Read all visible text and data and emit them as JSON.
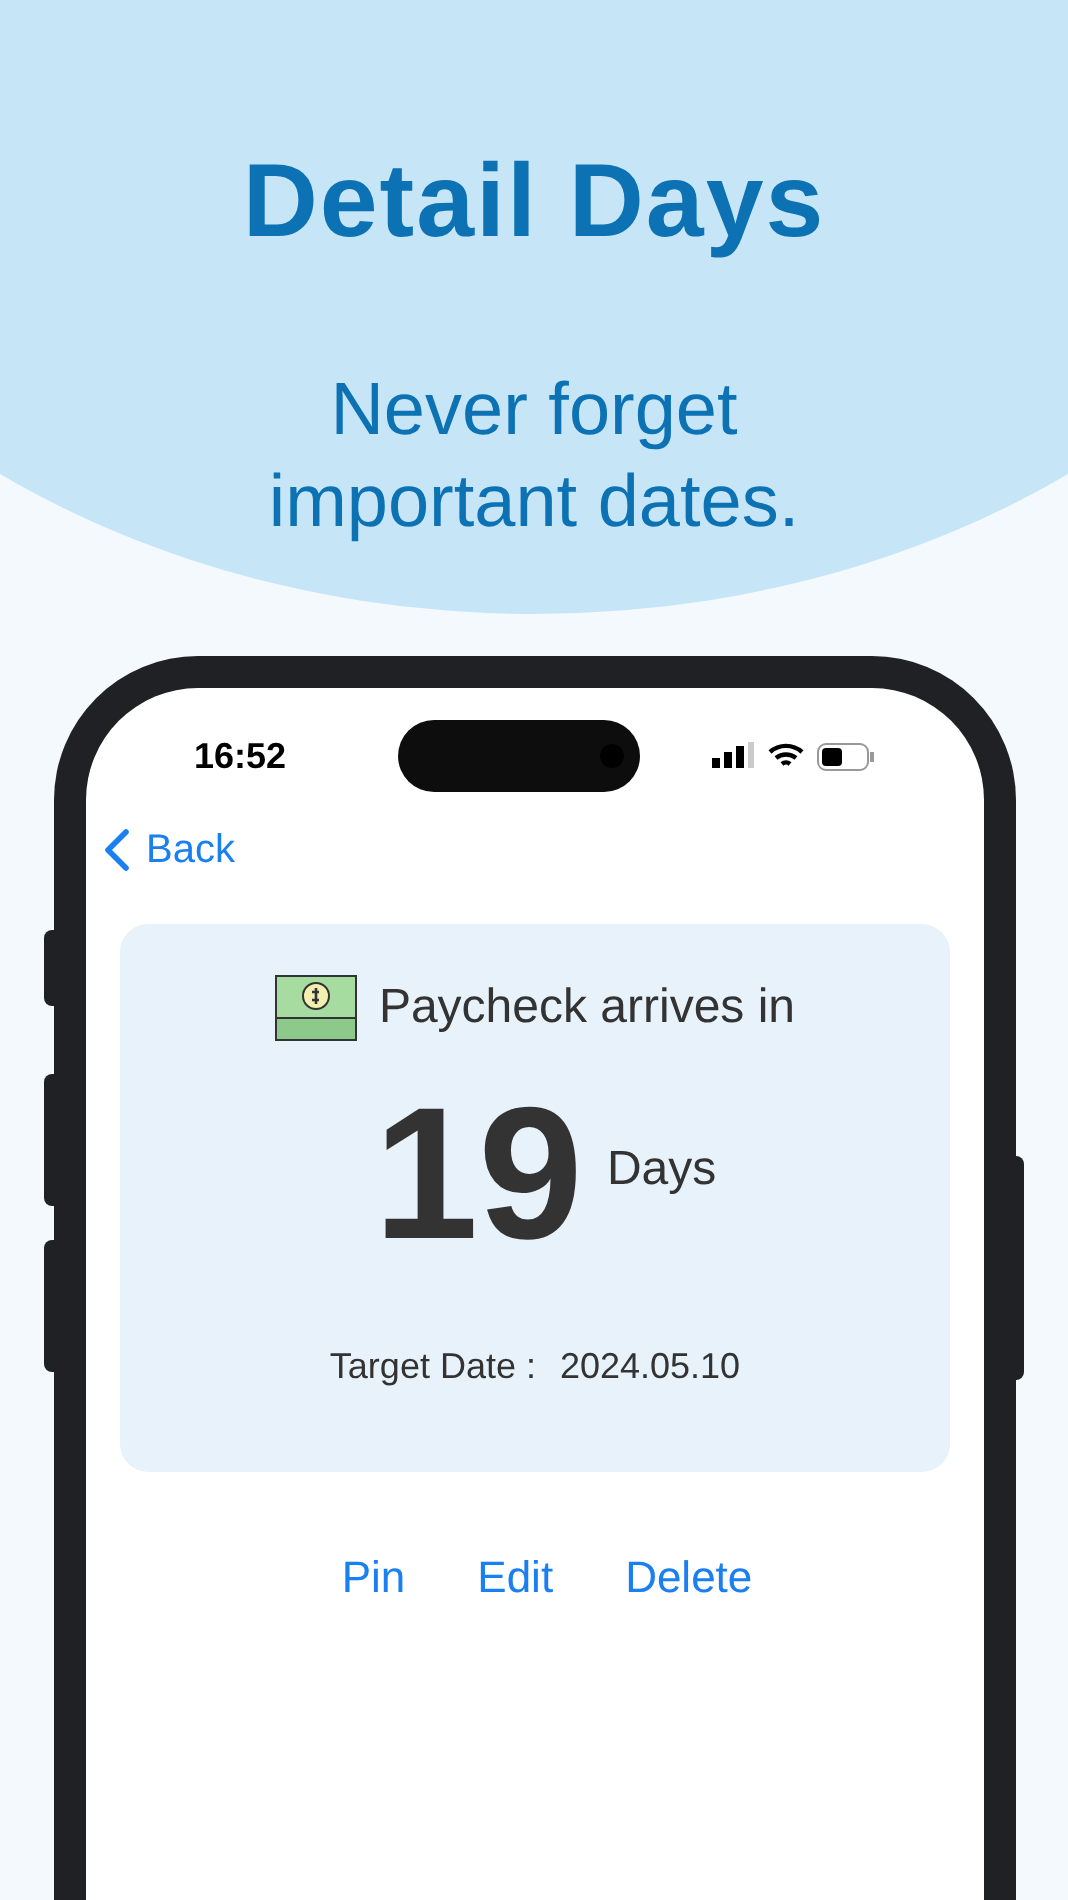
{
  "header": {
    "title": "Detail Days",
    "subtitle": "Never forget important dates."
  },
  "status_bar": {
    "time": "16:52"
  },
  "nav": {
    "back": "Back"
  },
  "card": {
    "event": "Paycheck arrives in",
    "count": "19",
    "unit": "Days",
    "date_label": "Target Date :",
    "date": "2024.05.10"
  },
  "actions": [
    "Pin",
    "Edit",
    "Delete"
  ]
}
